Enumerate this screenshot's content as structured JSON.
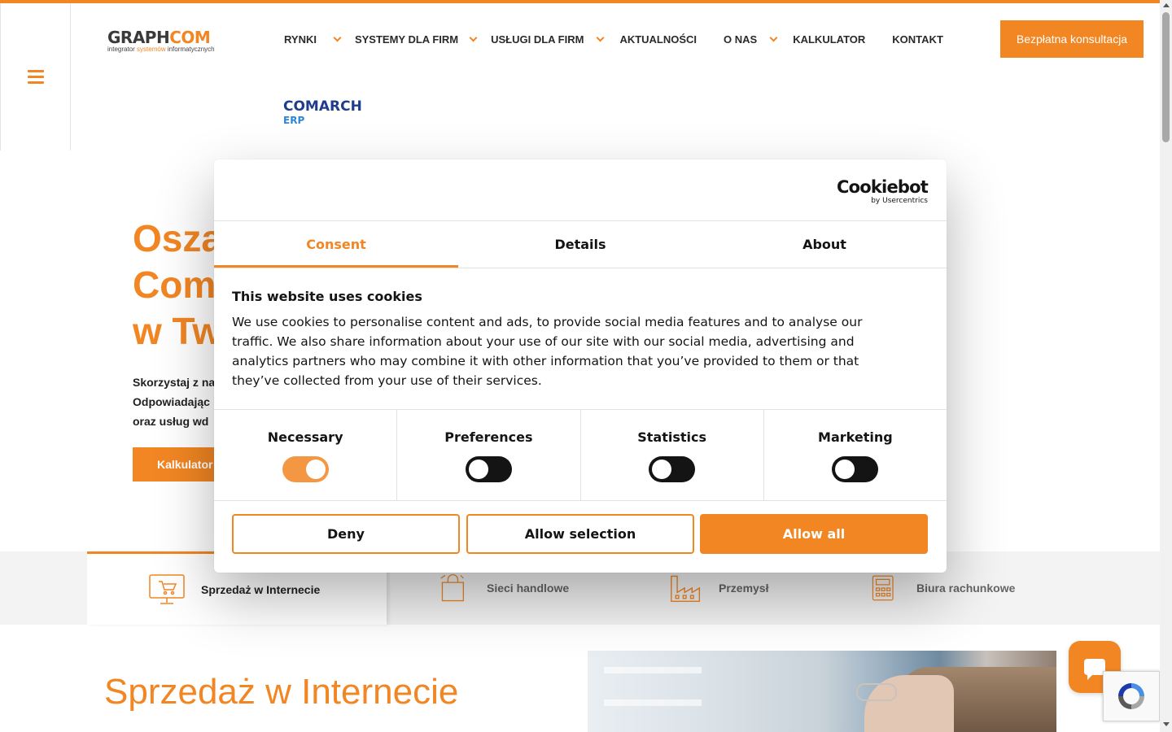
{
  "logo": {
    "brand_dark": "GRAPH",
    "brand_orange": "COM",
    "tagline_a": "integrator ",
    "tagline_b": "systemów",
    "tagline_c": " informatycznych"
  },
  "nav": {
    "items": [
      {
        "label": "RYNKI",
        "dropdown": true
      },
      {
        "label": "SYSTEMY DLA FIRM",
        "dropdown": true
      },
      {
        "label": "USŁUGI DLA FIRM",
        "dropdown": true
      },
      {
        "label": "AKTUALNOŚCI",
        "dropdown": false
      },
      {
        "label": "O NAS",
        "dropdown": true
      },
      {
        "label": "KALKULATOR",
        "dropdown": false
      },
      {
        "label": "KONTAKT",
        "dropdown": false
      }
    ],
    "cta": "Bezpłatna konsultacja"
  },
  "comarch": {
    "name": "COMARCH",
    "sub": "ERP"
  },
  "hero": {
    "title_lines": [
      "Osza",
      "Coma",
      "w Tw"
    ],
    "text_lines": [
      "Skorzystaj z na",
      "Odpowiadając",
      "oraz usług wd"
    ],
    "button": "Kalkulator"
  },
  "tabs": [
    {
      "label": "Sprzedaż w Internecie",
      "icon": "computer-cart-icon",
      "active": true
    },
    {
      "label": "Sieci handlowe",
      "icon": "shopping-bag-icon",
      "active": false
    },
    {
      "label": "Przemysł",
      "icon": "factory-icon",
      "active": false
    },
    {
      "label": "Biura rachunkowe",
      "icon": "calculator-icon",
      "active": false
    }
  ],
  "section": {
    "title": "Sprzedaż w Internecie"
  },
  "cookie": {
    "logo_main": "Cookiebot",
    "logo_sub": "by Usercentrics",
    "tabs": [
      "Consent",
      "Details",
      "About"
    ],
    "active_tab": "Consent",
    "heading": "This website uses cookies",
    "body": "We use cookies to personalise content and ads, to provide social media features and to analyse our traffic. We also share information about your use of our site with our social media, advertising and analytics partners who may combine it with other information that you’ve provided to them or that they’ve collected from your use of their services.",
    "categories": [
      {
        "label": "Necessary",
        "enabled": true
      },
      {
        "label": "Preferences",
        "enabled": false
      },
      {
        "label": "Statistics",
        "enabled": false
      },
      {
        "label": "Marketing",
        "enabled": false
      }
    ],
    "buttons": {
      "deny": "Deny",
      "allow_selection": "Allow selection",
      "allow_all": "Allow all"
    }
  },
  "colors": {
    "accent": "#f28623",
    "text": "#141414",
    "comarch_blue": "#1f3d8a",
    "erp_blue": "#2f86d4"
  }
}
